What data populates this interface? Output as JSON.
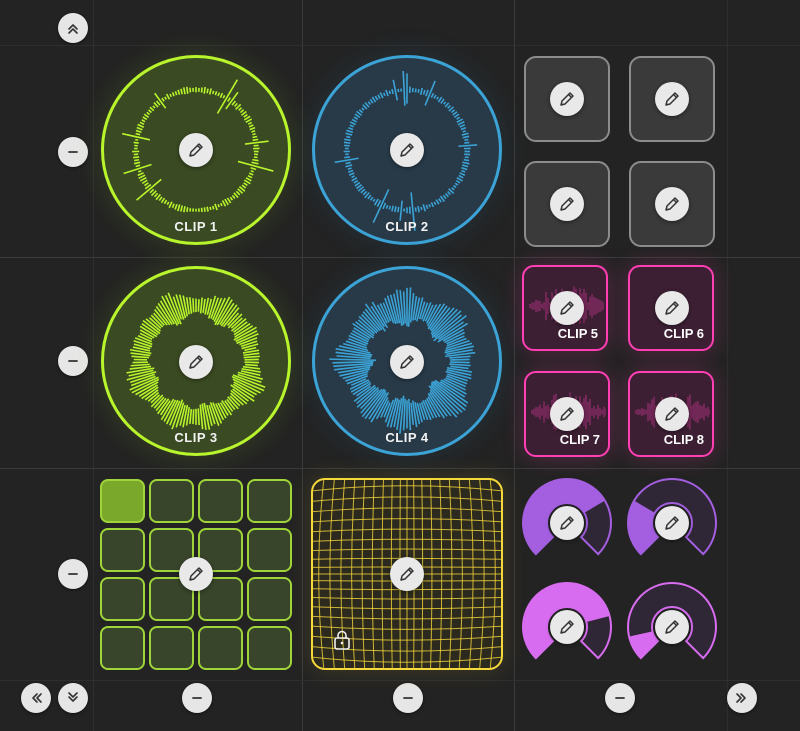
{
  "controls": {
    "scroll_top_icon": "double-chevron-up-icon",
    "scroll_left_icon": "double-chevron-left-icon",
    "scroll_bottom_icon": "double-chevron-down-icon",
    "scroll_right_icon": "double-chevron-right-icon",
    "row_remove_icon": "minus-icon",
    "column_remove_icon": "minus-icon"
  },
  "clips": {
    "clip1": {
      "label": "CLIP 1",
      "color": "#b8f52c"
    },
    "clip2": {
      "label": "CLIP 2",
      "color": "#3ba3d6"
    },
    "clip3": {
      "label": "CLIP 3",
      "color": "#b8f52c"
    },
    "clip4": {
      "label": "CLIP 4",
      "color": "#3ba3d6"
    },
    "clip5": {
      "label": "CLIP 5",
      "color": "#ff3fb4"
    },
    "clip6": {
      "label": "CLIP 6",
      "color": "#ff3fb4"
    },
    "clip7": {
      "label": "CLIP 7",
      "color": "#ff3fb4"
    },
    "clip8": {
      "label": "CLIP 8",
      "color": "#ff3fb4"
    }
  },
  "gray_pads": {
    "count": 4,
    "color": "#8c8c8c"
  },
  "step_grid": {
    "rows": 4,
    "cols": 4,
    "active_cells": [
      0
    ],
    "color": "#9fd43a"
  },
  "xy_pad": {
    "locked": true,
    "color": "#f5d83a",
    "lock_icon": "lock-icon"
  },
  "knobs": [
    {
      "level": 0.72,
      "color": "#a35fe0"
    },
    {
      "level": 0.28,
      "color": "#a35fe0"
    },
    {
      "level": 0.78,
      "color": "#d86cf0"
    },
    {
      "level": 0.12,
      "color": "#d86cf0"
    }
  ],
  "edit_icon": "pencil-icon"
}
